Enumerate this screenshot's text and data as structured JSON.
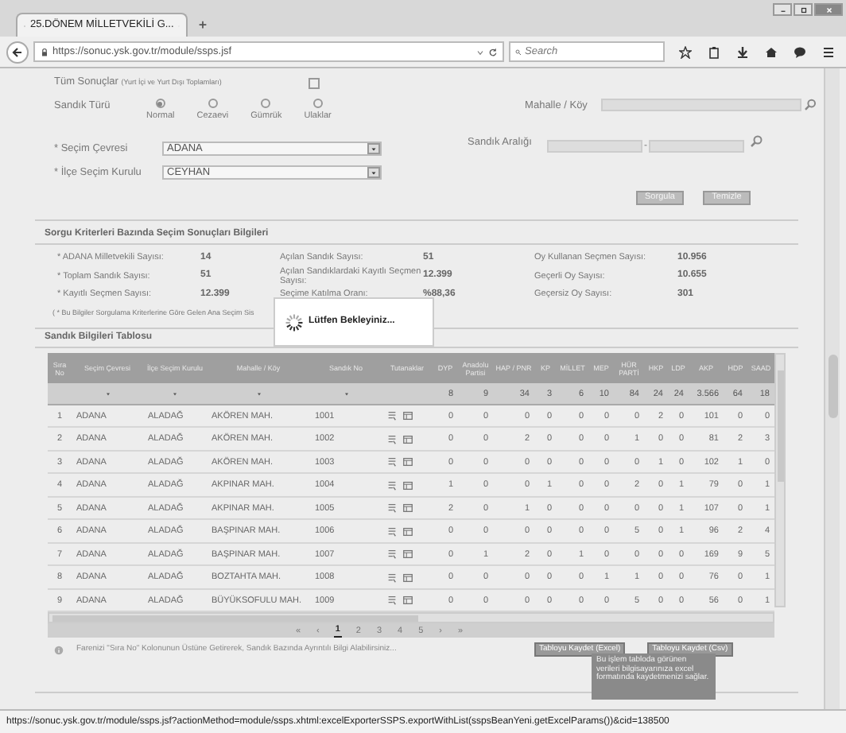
{
  "browser": {
    "tab_title": "25.DÖNEM MİLLETVEKİLİ G...",
    "url": "https://sonuc.ysk.gov.tr/module/ssps.jsf",
    "search": {
      "placeholder": "Search"
    },
    "status_url": "https://sonuc.ysk.gov.tr/module/ssps.jsf?actionMethod=module/ssps.xhtml:excelExporterSSPS.exportWithList(sspsBeanYeni.getExcelParams())&cid=138500"
  },
  "form": {
    "all_results": {
      "label": "Tüm Sonuçlar",
      "note": "(Yurt İçi ve Yurt Dışı Toplamları)",
      "checked": false
    },
    "ballot_type": {
      "label": "Sandık Türü",
      "options": [
        {
          "label": "Normal",
          "selected": true
        },
        {
          "label": "Cezaevi",
          "selected": false
        },
        {
          "label": "Gümrük",
          "selected": false
        },
        {
          "label": "Ulaklar",
          "selected": false
        }
      ]
    },
    "district": {
      "label": "* Seçim Çevresi",
      "value": "ADANA"
    },
    "county": {
      "label": "* İlçe Seçim Kurulu",
      "value": "CEYHAN"
    },
    "neighbourhood": {
      "label": "Mahalle / Köy"
    },
    "ballot_range": {
      "label": "Sandık Aralığı",
      "separator": "-"
    },
    "buttons": [
      "Sorgula",
      "Temizle"
    ]
  },
  "summary": {
    "title": "Sorgu Kriterleri Bazında Seçim Sonuçları Bilgileri",
    "columns": [
      [
        {
          "label": "* ADANA Milletvekili Sayısı:",
          "value": "14"
        },
        {
          "label": "* Toplam Sandık Sayısı:",
          "value": "51"
        },
        {
          "label": "* Kayıtlı Seçmen Sayısı:",
          "value": "12.399"
        }
      ],
      [
        {
          "label": "Açılan Sandık Sayısı:",
          "value": "51"
        },
        {
          "label": "Açılan Sandıklardaki Kayıtlı Seçmen Sayısı:",
          "value": "12.399"
        },
        {
          "label": "Seçime Katılma Oranı:",
          "value": "%88,36"
        }
      ],
      [
        {
          "label": "Oy Kullanan Seçmen Sayısı:",
          "value": "10.956"
        },
        {
          "label": "Geçerli Oy Sayısı:",
          "value": "10.655"
        },
        {
          "label": "Geçersiz Oy Sayısı:",
          "value": "301"
        }
      ]
    ],
    "footnote": "( * Bu Bilgiler Sorgulama Kriterlerine Göre Gelen Ana Seçim Sis"
  },
  "loading": "Lütfen Bekleyiniz...",
  "table": {
    "title": "Sandık Bilgileri Tablosu",
    "columns": [
      "Sıra No",
      "Seçim Çevresi",
      "İlçe Seçim Kurulu",
      "Mahalle / Köy",
      "Sandık No",
      "Tutanaklar",
      "DYP",
      "Anadolu Partisi",
      "HAP / PNR",
      "KP",
      "MİLLET",
      "MEP",
      "HÜR PARTİ",
      "HKP",
      "LDP",
      "AKP",
      "HDP",
      "SAAD"
    ],
    "totals": [
      "8",
      "9",
      "34",
      "3",
      "6",
      "10",
      "84",
      "24",
      "24",
      "3.566",
      "64",
      "18"
    ],
    "rows": [
      {
        "cells": [
          "1",
          "ADANA",
          "ALADAĞ",
          "AKÖREN MAH.",
          "1001"
        ],
        "votes": [
          "0",
          "0",
          "0",
          "0",
          "0",
          "0",
          "0",
          "2",
          "0",
          "101",
          "0",
          "0"
        ]
      },
      {
        "cells": [
          "2",
          "ADANA",
          "ALADAĞ",
          "AKÖREN MAH.",
          "1002"
        ],
        "votes": [
          "0",
          "0",
          "2",
          "0",
          "0",
          "0",
          "1",
          "0",
          "0",
          "81",
          "2",
          "3"
        ]
      },
      {
        "cells": [
          "3",
          "ADANA",
          "ALADAĞ",
          "AKÖREN MAH.",
          "1003"
        ],
        "votes": [
          "0",
          "0",
          "0",
          "0",
          "0",
          "0",
          "0",
          "1",
          "0",
          "102",
          "1",
          "0"
        ]
      },
      {
        "cells": [
          "4",
          "ADANA",
          "ALADAĞ",
          "AKPINAR MAH.",
          "1004"
        ],
        "votes": [
          "1",
          "0",
          "0",
          "1",
          "0",
          "0",
          "2",
          "0",
          "1",
          "79",
          "0",
          "1"
        ]
      },
      {
        "cells": [
          "5",
          "ADANA",
          "ALADAĞ",
          "AKPINAR MAH.",
          "1005"
        ],
        "votes": [
          "2",
          "0",
          "1",
          "0",
          "0",
          "0",
          "0",
          "0",
          "1",
          "107",
          "0",
          "1"
        ]
      },
      {
        "cells": [
          "6",
          "ADANA",
          "ALADAĞ",
          "BAŞPINAR MAH.",
          "1006"
        ],
        "votes": [
          "0",
          "0",
          "0",
          "0",
          "0",
          "0",
          "5",
          "0",
          "1",
          "96",
          "2",
          "4"
        ]
      },
      {
        "cells": [
          "7",
          "ADANA",
          "ALADAĞ",
          "BAŞPINAR MAH.",
          "1007"
        ],
        "votes": [
          "0",
          "1",
          "2",
          "0",
          "1",
          "0",
          "0",
          "0",
          "0",
          "169",
          "9",
          "5"
        ]
      },
      {
        "cells": [
          "8",
          "ADANA",
          "ALADAĞ",
          "BOZTAHTA MAH.",
          "1008"
        ],
        "votes": [
          "0",
          "0",
          "0",
          "0",
          "0",
          "1",
          "1",
          "0",
          "0",
          "76",
          "0",
          "1"
        ]
      },
      {
        "cells": [
          "9",
          "ADANA",
          "ALADAĞ",
          "BÜYÜKSOFULU MAH.",
          "1009"
        ],
        "votes": [
          "0",
          "0",
          "0",
          "0",
          "0",
          "0",
          "5",
          "0",
          "0",
          "56",
          "0",
          "1"
        ]
      }
    ],
    "pager": [
      {
        "label": "«",
        "selected": false
      },
      {
        "label": "‹",
        "selected": false
      },
      {
        "label": "1",
        "selected": true
      },
      {
        "label": "2",
        "selected": false
      },
      {
        "label": "3",
        "selected": false
      },
      {
        "label": "4",
        "selected": false
      },
      {
        "label": "5",
        "selected": false
      },
      {
        "label": "›",
        "selected": false
      },
      {
        "label": "»",
        "selected": false
      }
    ]
  },
  "info": "Farenizi \"Sıra No\" Kolonunun Üstüne Getirerek, Sandık Bazında Ayrıntılı Bilgi Alabilirsiniz...",
  "export_buttons": [
    "Tabloyu Kaydet (Excel)",
    "Tabloyu Kaydet (Csv)"
  ],
  "tooltip": "Bu işlem tabloda görünen verileri bilgisayarınıza excel formatında kaydetmenizi sağlar."
}
